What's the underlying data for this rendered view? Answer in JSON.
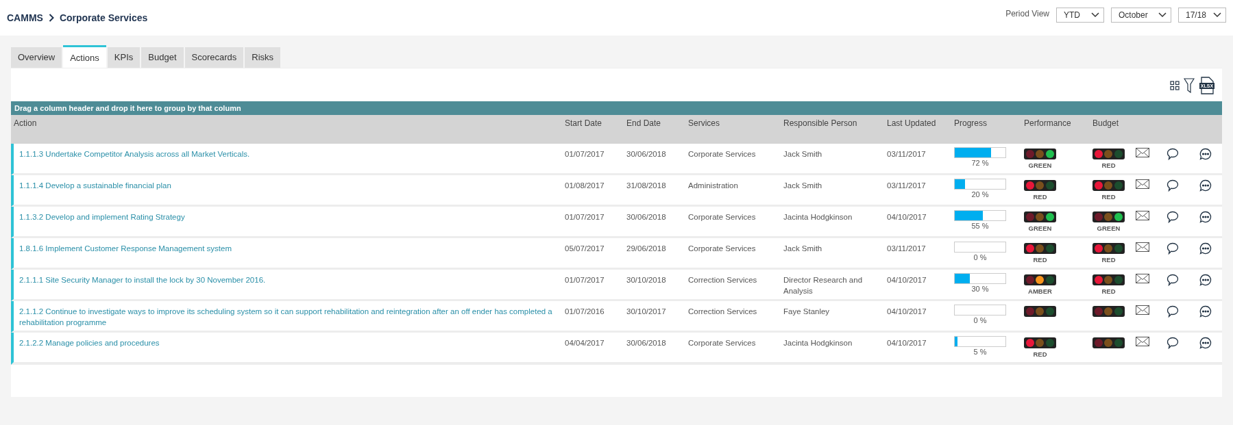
{
  "breadcrumb": [
    {
      "label": "CAMMS"
    },
    {
      "label": "Corporate Services"
    }
  ],
  "period": {
    "label": "Period View",
    "selects": [
      {
        "value": "YTD"
      },
      {
        "value": "October"
      },
      {
        "value": "17/18"
      }
    ]
  },
  "tabs": [
    {
      "label": "Overview",
      "selected": false
    },
    {
      "label": "Actions",
      "selected": true
    },
    {
      "label": "KPIs",
      "selected": false
    },
    {
      "label": "Budget",
      "selected": false
    },
    {
      "label": "Scorecards",
      "selected": false
    },
    {
      "label": "Risks",
      "selected": false
    }
  ],
  "toolbar": {
    "export_label": "XLSX"
  },
  "group_bar": "Drag a column header and drop it here to group by that column",
  "table": {
    "columns": [
      "Action",
      "Start Date",
      "End Date",
      "Services",
      "Responsible Person",
      "Last Updated",
      "Progress",
      "Performance",
      "Budget"
    ],
    "rows": [
      {
        "action": "1.1.1.3 Undertake Competitor Analysis across all Market Verticals.",
        "start": "01/07/2017",
        "end": "30/06/2018",
        "service": "Corporate Services",
        "person": "Jack Smith",
        "updated": "03/11/2017",
        "level": 0.72,
        "percent": "72 %",
        "performance": {
          "red_lit": false,
          "amber_lit": false,
          "green_lit": true,
          "label": "GREEN"
        },
        "budget": {
          "red_lit": true,
          "amber_lit": false,
          "green_lit": false,
          "label": "RED"
        }
      },
      {
        "action": "1.1.1.4 Develop a sustainable financial plan",
        "start": "01/08/2017",
        "end": "31/08/2018",
        "service": "Administration",
        "person": "Jack Smith",
        "updated": "03/11/2017",
        "level": 0.2,
        "percent": "20 %",
        "performance": {
          "red_lit": true,
          "amber_lit": false,
          "green_lit": false,
          "label": "RED"
        },
        "budget": {
          "red_lit": true,
          "amber_lit": false,
          "green_lit": false,
          "label": "RED"
        }
      },
      {
        "action": "1.1.3.2 Develop and implement Rating Strategy",
        "start": "01/07/2017",
        "end": "30/06/2018",
        "service": "Corporate Services",
        "person": "Jacinta Hodgkinson",
        "updated": "04/10/2017",
        "level": 0.55,
        "percent": "55 %",
        "performance": {
          "red_lit": false,
          "amber_lit": false,
          "green_lit": true,
          "label": "GREEN"
        },
        "budget": {
          "red_lit": false,
          "amber_lit": false,
          "green_lit": true,
          "label": "GREEN"
        }
      },
      {
        "action": "1.8.1.6 Implement Customer Response Management system",
        "start": "05/07/2017",
        "end": "29/06/2018",
        "service": "Corporate Services",
        "person": "Jack Smith",
        "updated": "03/11/2017",
        "level": 0,
        "percent": "0 %",
        "performance": {
          "red_lit": true,
          "amber_lit": false,
          "green_lit": false,
          "label": "RED"
        },
        "budget": {
          "red_lit": true,
          "amber_lit": false,
          "green_lit": false,
          "label": "RED"
        }
      },
      {
        "action": "2.1.1.1 Site Security Manager to install the lock by 30 November 2016.",
        "start": "01/07/2017",
        "end": "30/10/2018",
        "service": "Correction Services",
        "person": "Director Research and Analysis",
        "updated": "04/10/2017",
        "level": 0.3,
        "percent": "30 %",
        "performance": {
          "red_lit": false,
          "amber_lit": true,
          "green_lit": false,
          "label": "AMBER"
        },
        "budget": {
          "red_lit": true,
          "amber_lit": false,
          "green_lit": false,
          "label": "RED"
        }
      },
      {
        "action": "2.1.1.2 Continue to investigate ways to improve its scheduling system so it can support rehabilitation and reintegration after an off ender has completed a rehabilitation programme",
        "start": "01/07/2016",
        "end": "30/10/2017",
        "service": "Correction Services",
        "person": "Faye Stanley",
        "updated": "04/10/2017",
        "level": 0,
        "percent": "0 %",
        "performance": {
          "red_lit": false,
          "amber_lit": false,
          "green_lit": false
        },
        "budget": {
          "red_lit": false,
          "amber_lit": false,
          "green_lit": false
        }
      },
      {
        "action": "2.1.2.2 Manage policies and procedures",
        "start": "04/04/2017",
        "end": "30/06/2018",
        "service": "Corporate Services",
        "person": "Jacinta Hodgkinson",
        "updated": "04/10/2017",
        "level": 0.05,
        "percent": "5 %",
        "performance": {
          "red_lit": true,
          "amber_lit": false,
          "green_lit": false,
          "label": "RED"
        },
        "budget": {
          "red_lit": false,
          "amber_lit": false,
          "green_lit": false
        }
      }
    ]
  }
}
